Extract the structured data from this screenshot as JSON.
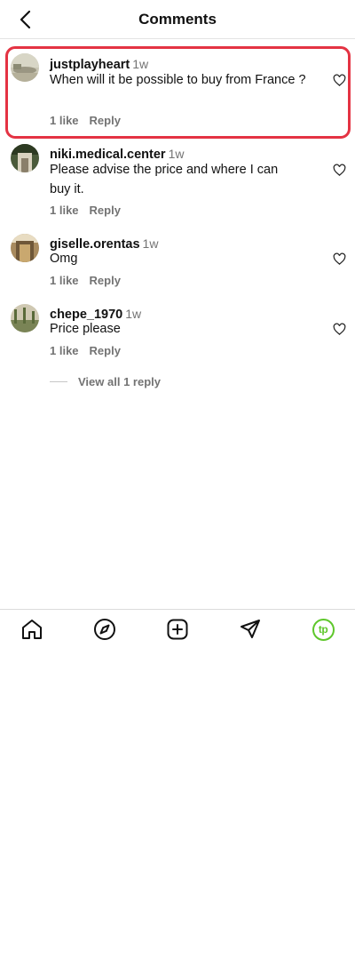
{
  "header": {
    "title": "Comments"
  },
  "comments": [
    {
      "username": "justplayheart",
      "time": "1w",
      "text": "When will it be possible to buy from France ?",
      "likes": "1 like",
      "reply": "Reply"
    },
    {
      "username": "niki.medical.center",
      "time": "1w",
      "text": "Please advise the price and where I can buy it.",
      "likes": "1 like",
      "reply": "Reply"
    },
    {
      "username": "giselle.orentas",
      "time": "1w",
      "text": "Omg",
      "likes": "1 like",
      "reply": "Reply"
    },
    {
      "username": "chepe_1970",
      "time": "1w",
      "text": "Price please",
      "likes": "1 like",
      "reply": "Reply"
    }
  ],
  "view_replies": "View all 1 reply",
  "tabbar": {
    "icons": [
      "home-icon",
      "explore-icon",
      "create-icon",
      "direct-icon",
      "profile-icon"
    ],
    "profile_initials": "tp",
    "accent_color": "#5ec72b"
  },
  "colors": {
    "highlight": "#e43343",
    "muted": "#737373"
  }
}
